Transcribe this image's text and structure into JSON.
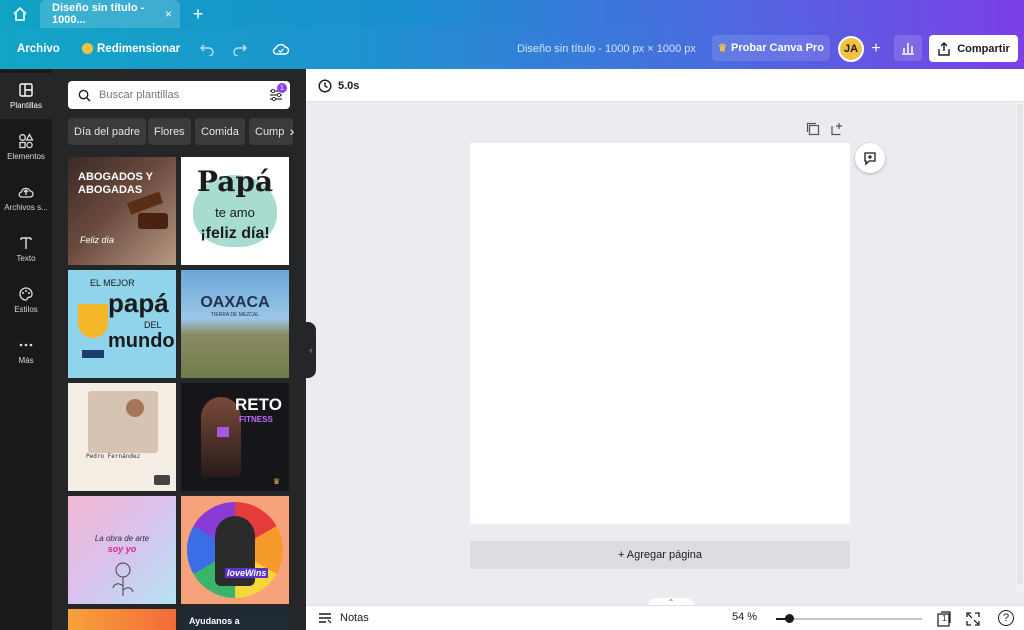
{
  "tab": {
    "title": "Diseño sin título - 1000...",
    "close": "×",
    "new_tab": "+"
  },
  "toolbar": {
    "file_label": "Archivo",
    "resize_label": "Redimensionar",
    "doc_title": "Diseño sin título - 1000 px × 1000 px",
    "pro_label": "Probar Canva Pro",
    "avatar_initials": "JA",
    "add_member": "+",
    "share_label": "Compartir"
  },
  "rail": {
    "items": [
      {
        "label": "Plantillas",
        "icon": "templates-icon"
      },
      {
        "label": "Elementos",
        "icon": "elements-icon"
      },
      {
        "label": "Archivos s...",
        "icon": "upload-icon"
      },
      {
        "label": "Texto",
        "icon": "text-icon"
      },
      {
        "label": "Estilos",
        "icon": "palette-icon"
      },
      {
        "label": "Más",
        "icon": "more-icon"
      }
    ]
  },
  "panel": {
    "search_placeholder": "Buscar plantillas",
    "filter_count": "1",
    "chips": [
      "Día del padre",
      "Flores",
      "Comida",
      "Cump"
    ],
    "templates": [
      {
        "lines": [
          "ABOGADOS Y",
          "ABOGADAS"
        ],
        "sub": "Feliz día"
      },
      {
        "lines": [
          "Papá",
          "te amo",
          "¡feliz día!"
        ]
      },
      {
        "lines": [
          "EL MEJOR",
          "papá",
          "DEL",
          "mundo"
        ]
      },
      {
        "lines": [
          "OAXACA"
        ],
        "sub": "TIERRA DE MEZCAL"
      },
      {
        "lines": [
          "Pedro Fernández"
        ]
      },
      {
        "lines": [
          "RETO",
          "FITNESS"
        ]
      },
      {
        "lines": [
          "La obra de arte",
          "soy yo"
        ]
      },
      {
        "lines": [
          "loveWins"
        ]
      },
      {
        "lines": [
          ""
        ]
      },
      {
        "lines": [
          "Ayudanos a"
        ]
      }
    ]
  },
  "canvas": {
    "duration": "5.0s",
    "add_page": "+ Agregar página"
  },
  "footer": {
    "notes": "Notas",
    "zoom": "54 %",
    "zoom_fraction": 0.09,
    "page_count": "1",
    "help": "?"
  },
  "colors": {
    "brand_purple": "#8b3dff",
    "gold": "#f5c143",
    "panel_bg": "#252627",
    "rail_bg": "#18191b"
  }
}
